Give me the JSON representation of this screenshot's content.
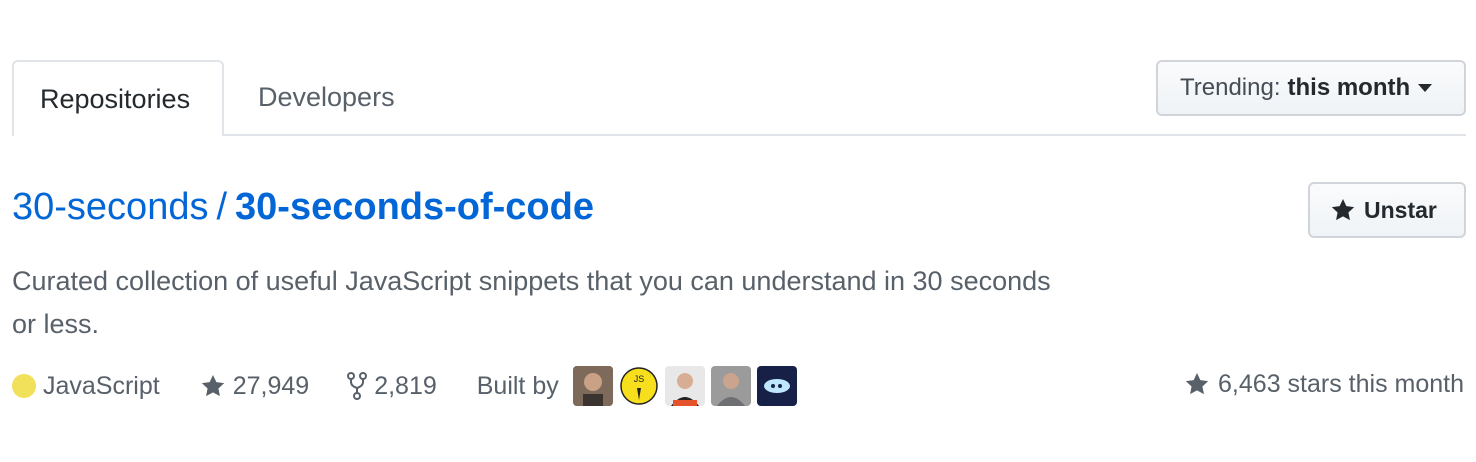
{
  "tabs": [
    {
      "label": "Repositories",
      "active": true
    },
    {
      "label": "Developers",
      "active": false
    }
  ],
  "trending": {
    "label": "Trending:",
    "value": "this month"
  },
  "repo": {
    "owner": "30-seconds",
    "separator": "/",
    "name": "30-seconds-of-code",
    "description": "Curated collection of useful JavaScript snippets that you can understand in 30 seconds or less.",
    "language": "JavaScript",
    "language_color": "#f1e05a",
    "stars": "27,949",
    "forks": "2,819",
    "built_by_label": "Built by",
    "contributors": [
      "contributor-1",
      "contributor-2",
      "contributor-3",
      "contributor-4",
      "contributor-5"
    ],
    "stars_this_month": "6,463 stars this month"
  },
  "actions": {
    "unstar_label": "Unstar"
  },
  "colors": {
    "link": "#0366d6",
    "muted": "#586069",
    "border": "#e1e4e8"
  }
}
